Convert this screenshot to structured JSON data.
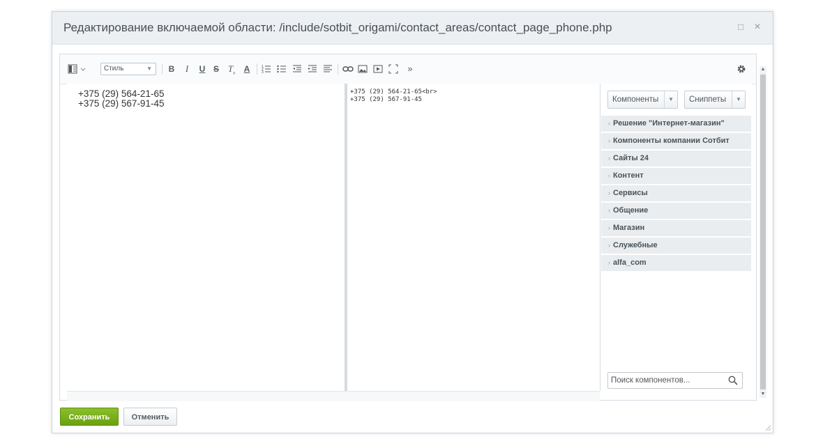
{
  "dialog": {
    "title": "Редактирование включаемой области: /include/sotbit_origami/contact_areas/contact_page_phone.php",
    "maximize_glyph": "□",
    "close_glyph": "×"
  },
  "toolbar": {
    "style_label": "Стиль",
    "more_glyph": "»",
    "icons": [
      "view-mode-icon",
      "bold-icon",
      "italic-icon",
      "underline-icon",
      "strikethrough-icon",
      "clear-format-icon",
      "text-color-icon",
      "ordered-list-icon",
      "unordered-list-icon",
      "outdent-icon",
      "indent-icon",
      "align-icon",
      "link-icon",
      "image-icon",
      "video-icon",
      "fullscreen-icon",
      "more-icon",
      "settings-icon"
    ]
  },
  "content": {
    "wysiwyg_lines": [
      "+375 (29) 564-21-65",
      "+375 (29) 567-91-45"
    ],
    "code_lines": [
      "+375 (29) 564-21-65<br>",
      "+375 (29) 567-91-45"
    ]
  },
  "sidebar": {
    "components_label": "Компоненты",
    "snippets_label": "Сниппеты",
    "items": [
      {
        "label": "Решение \"Интернет-магазин\""
      },
      {
        "label": "Компоненты компании Сотбит"
      },
      {
        "label": "Сайты 24"
      },
      {
        "label": "Контент"
      },
      {
        "label": "Сервисы"
      },
      {
        "label": "Общение"
      },
      {
        "label": "Магазин"
      },
      {
        "label": "Служебные"
      },
      {
        "label": "alfa_com"
      }
    ],
    "search_placeholder": "Поиск компонентов..."
  },
  "footer": {
    "save_label": "Сохранить",
    "cancel_label": "Отменить"
  },
  "colors": {
    "save_button": "#76ab12",
    "titlebar": "#ecf0f3",
    "list_item_bg": "#e9edef"
  }
}
